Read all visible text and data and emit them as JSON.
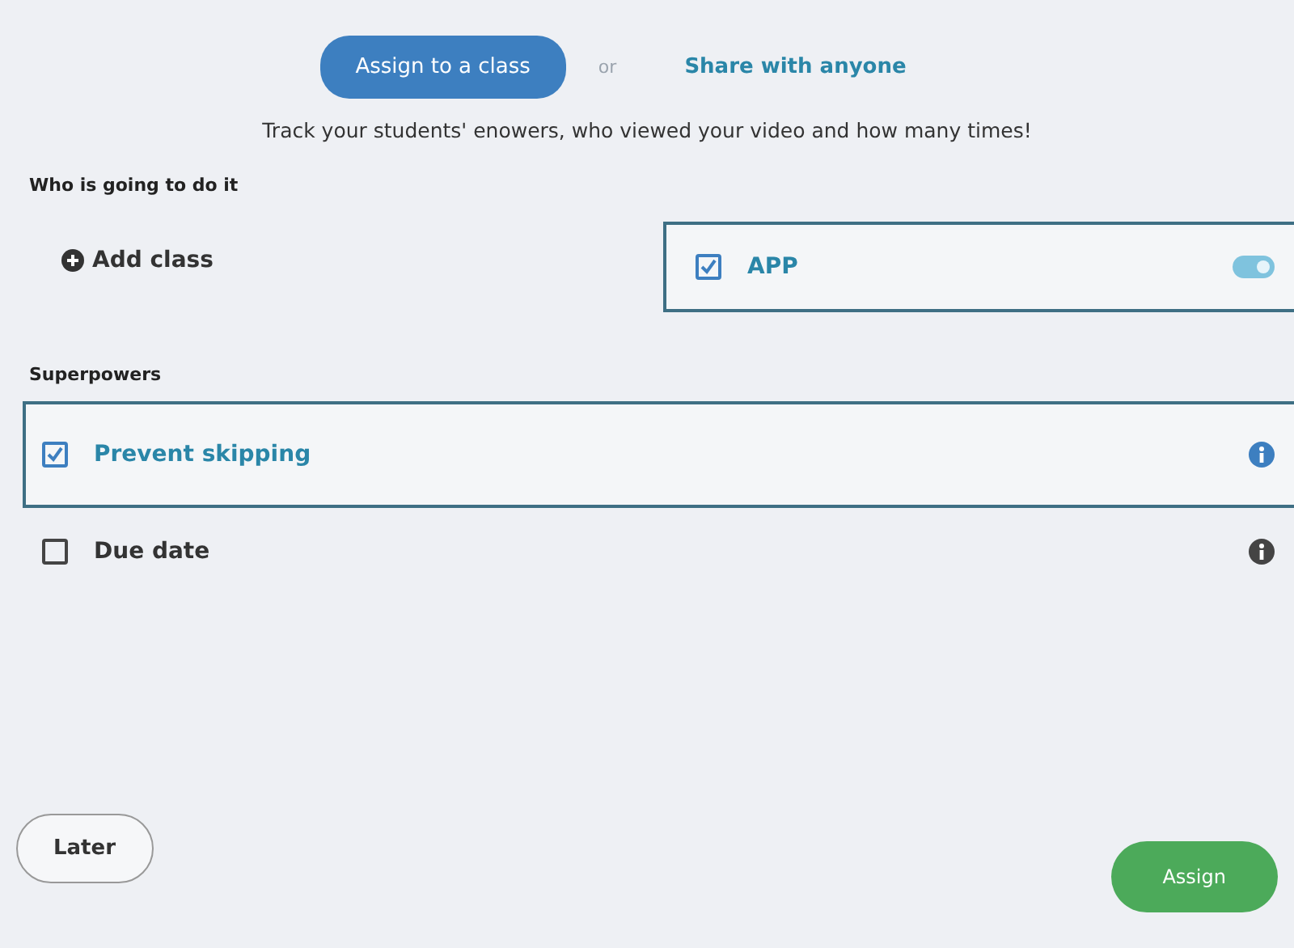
{
  "modes": [
    {
      "label": "Assign to a class",
      "selected": true
    },
    {
      "label": "Share with anyone",
      "selected": false
    }
  ],
  "separator": "or",
  "subtitle": "Track your students' enowers, who viewed your video and how many times!",
  "who_section": {
    "heading": "Who is going to do it",
    "add_label": "Add class",
    "classes": [
      {
        "name": "APP",
        "checked": true
      }
    ]
  },
  "superpowers": {
    "heading": "Superpowers",
    "items": [
      {
        "label": "Prevent skipping",
        "checked": true
      },
      {
        "label": "Due date",
        "checked": false
      }
    ]
  },
  "actions": {
    "later": "Later",
    "assign": "Assign"
  }
}
